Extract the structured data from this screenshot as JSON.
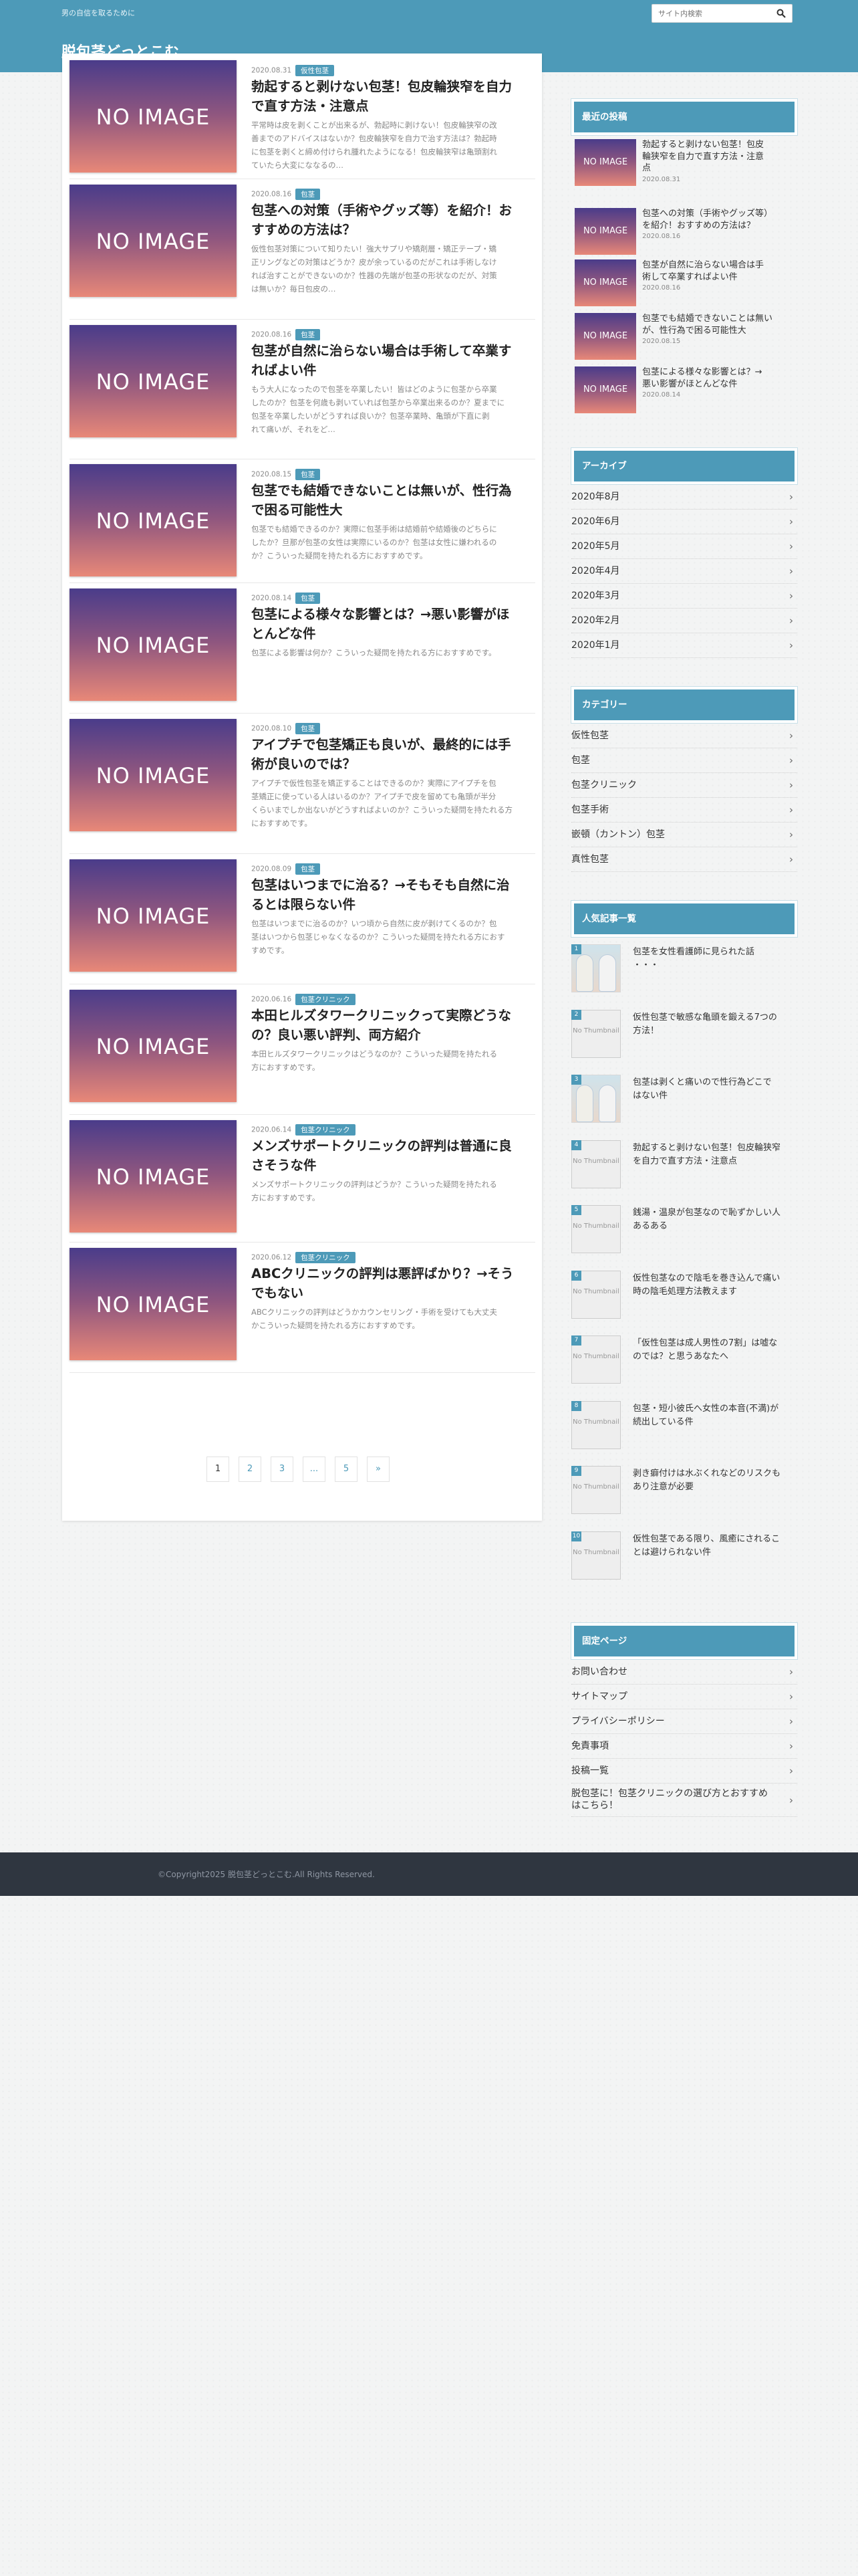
{
  "header": {
    "tagline": "男の自信を取るために",
    "title": "脱包茎どっとこむ",
    "search_placeholder": "サイト内検索",
    "search_icon": "search-icon"
  },
  "posts": [
    {
      "date": "2020.08.31",
      "category": "仮性包茎",
      "title_lines": [
        "勃起すると剥けない包茎！包皮輪狭窄を自力",
        "で直す方法・注意点"
      ],
      "excerpt_lines": [
        "平常時は皮を剥くことが出来るが、勃起時に剥けない！包皮輪狭窄の改",
        "善までのアドバイスはないか？包皮輪狭窄を自力で治す方法は？勃起時",
        "に包茎を剥くと締め付けられ腫れたようになる！包皮輪狭窄は亀頭割れ",
        "ていたら大変にななるの…"
      ],
      "thumb": "NO IMAGE"
    },
    {
      "date": "2020.08.16",
      "category": "包茎",
      "title_lines": [
        "包茎への対策（手術やグッズ等）を紹介！お",
        "すすめの方法は？"
      ],
      "excerpt_lines": [
        "仮性包茎対策について知りたい！強大サプリや矯剤層・矯正テープ・矯",
        "正リングなどの対策はどうか？皮が余っているのだがこれは手術しなけ",
        "れば治すことができないのか？性器の先端が包茎の形状なのだが、対策",
        "は無いか？毎日包皮の…"
      ],
      "thumb": "NO IMAGE"
    },
    {
      "date": "2020.08.16",
      "category": "包茎",
      "title_lines": [
        "包茎が自然に治らない場合は手術して卒業す",
        "ればよい件"
      ],
      "excerpt_lines": [
        "もう大人になったので包茎を卒業したい！皆はどのように包茎から卒業",
        "したのか？包茎を何歳も剥いていれば包茎から卒業出来るのか？夏までに",
        "包茎を卒業したいがどうすれば良いか？包茎卒業時、亀頭が下直に剥",
        "れて痛いが、それをど…"
      ],
      "thumb": "NO IMAGE"
    },
    {
      "date": "2020.08.15",
      "category": "包茎",
      "title_lines": [
        "包茎でも結婚できないことは無いが、性行為",
        "で困る可能性大"
      ],
      "excerpt_lines": [
        "包茎でも結婚できるのか？実際に包茎手術は結婚前や結婚後のどちらに",
        "したか？旦那が包茎の女性は実際にいるのか？包茎は女性に嫌われるの",
        "か？こういった疑問を持たれる方におすすめです。"
      ],
      "thumb": "NO IMAGE"
    },
    {
      "date": "2020.08.14",
      "category": "包茎",
      "title_lines": [
        "包茎による様々な影響とは？→悪い影響がほ",
        "とんどな件"
      ],
      "excerpt_lines": [
        "包茎による影響は何か？こういった疑問を持たれる方におすすめです。"
      ],
      "thumb": "NO IMAGE"
    },
    {
      "date": "2020.08.10",
      "category": "包茎",
      "title_lines": [
        "アイプチで包茎矯正も良いが、最終的には手",
        "術が良いのでは？"
      ],
      "excerpt_lines": [
        "アイプチで仮性包茎を矯正することはできるのか？実際にアイプチを包",
        "茎矯正に使っている人はいるのか？アイプチで皮を留めても亀頭が半分",
        "くらいまでしか出ないがどうすればよいのか？こういった疑問を持たれる方",
        "におすすめです。"
      ],
      "thumb": "NO IMAGE"
    },
    {
      "date": "2020.08.09",
      "category": "包茎",
      "title_lines": [
        "包茎はいつまでに治る？→そもそも自然に治",
        "るとは限らない件"
      ],
      "excerpt_lines": [
        "包茎はいつまでに治るのか？いつ頃から自然に皮が剥けてくるのか？包",
        "茎はいつから包茎じゃなくなるのか？こういった疑問を持たれる方におす",
        "すめです。"
      ],
      "thumb": "NO IMAGE"
    },
    {
      "date": "2020.06.16",
      "category": "包茎クリニック",
      "title_lines": [
        "本田ヒルズタワークリニックって実際どうな",
        "の？良い悪い評判、両方紹介"
      ],
      "excerpt_lines": [
        "本田ヒルズタワークリニックはどうなのか？こういった疑問を持たれる",
        "方におすすめです。"
      ],
      "thumb": "NO IMAGE"
    },
    {
      "date": "2020.06.14",
      "category": "包茎クリニック",
      "title_lines": [
        "メンズサポートクリニックの評判は普通に良",
        "さそうな件"
      ],
      "excerpt_lines": [
        "メンズサポートクリニックの評判はどうか？こういった疑問を持たれる",
        "方におすすめです。"
      ],
      "thumb": "NO IMAGE"
    },
    {
      "date": "2020.06.12",
      "category": "包茎クリニック",
      "title_lines": [
        "ABCクリニックの評判は悪評ばかり？→そう",
        "でもない"
      ],
      "excerpt_lines": [
        "ABCクリニックの評判はどうかカウンセリング・手術を受けても大丈夫",
        "かこういった疑問を持たれる方におすすめです。"
      ],
      "thumb": "NO IMAGE"
    }
  ],
  "pagination": [
    "1",
    "2",
    "3",
    "...",
    "5",
    "»"
  ],
  "sidebar": {
    "recent": {
      "title": "最近の投稿",
      "items": [
        {
          "title_lines": [
            "勃起すると剥けない包茎！包皮",
            "輪狭窄を自力で直す方法・注意",
            "点"
          ],
          "date": "2020.08.31",
          "thumb": "NO IMAGE"
        },
        {
          "title_lines": [
            "包茎への対策（手術やグッズ等）",
            "を紹介！おすすめの方法は？"
          ],
          "date": "2020.08.16",
          "thumb": "NO IMAGE"
        },
        {
          "title_lines": [
            "包茎が自然に治らない場合は手",
            "術して卒業すればよい件"
          ],
          "date": "2020.08.16",
          "thumb": "NO IMAGE"
        },
        {
          "title_lines": [
            "包茎でも結婚できないことは無い",
            "が、性行為で困る可能性大"
          ],
          "date": "2020.08.15",
          "thumb": "NO IMAGE"
        },
        {
          "title_lines": [
            "包茎による様々な影響とは？→",
            "悪い影響がほとんどな件"
          ],
          "date": "2020.08.14",
          "thumb": "NO IMAGE"
        }
      ]
    },
    "archive": {
      "title": "アーカイブ",
      "items": [
        "2020年8月",
        "2020年6月",
        "2020年5月",
        "2020年4月",
        "2020年3月",
        "2020年2月",
        "2020年1月"
      ]
    },
    "categories": {
      "title": "カテゴリー",
      "items": [
        "仮性包茎",
        "包茎",
        "包茎クリニック",
        "包茎手術",
        "嵌頓（カントン）包茎",
        "真性包茎"
      ]
    },
    "popular": {
      "title": "人気記事一覧",
      "items": [
        {
          "rank": "1",
          "title_lines": [
            "包茎を女性看護師に見られた話",
            "・・・"
          ],
          "thumb": "photo"
        },
        {
          "rank": "2",
          "title_lines": [
            "仮性包茎で敏感な亀頭を鍛える7つの",
            "方法！"
          ],
          "thumb": "No Thumbnail"
        },
        {
          "rank": "3",
          "title_lines": [
            "包茎は剥くと痛いので性行為どこで",
            "はない件"
          ],
          "thumb": "photo"
        },
        {
          "rank": "4",
          "title_lines": [
            "勃起すると剥けない包茎！包皮輪狭窄",
            "を自力で直す方法・注意点"
          ],
          "thumb": "No Thumbnail"
        },
        {
          "rank": "5",
          "title_lines": [
            "銭湯・温泉が包茎なので恥ずかしい人",
            "あるある"
          ],
          "thumb": "No Thumbnail"
        },
        {
          "rank": "6",
          "title_lines": [
            "仮性包茎なので陰毛を巻き込んで痛い",
            "時の陰毛処理方法教えます"
          ],
          "thumb": "No Thumbnail"
        },
        {
          "rank": "7",
          "title_lines": [
            "「仮性包茎は成人男性の7割」は嘘な",
            "のでは？と思うあなたへ"
          ],
          "thumb": "No Thumbnail"
        },
        {
          "rank": "8",
          "title_lines": [
            "包茎・短小彼氏へ女性の本音(不満)が",
            "続出している件"
          ],
          "thumb": "No Thumbnail"
        },
        {
          "rank": "9",
          "title_lines": [
            "剥き癖付けは水ぶくれなどのリスクも",
            "あり注意が必要"
          ],
          "thumb": "No Thumbnail"
        },
        {
          "rank": "10",
          "title_lines": [
            "仮性包茎である限り、風癒にされるこ",
            "とは避けられない件"
          ],
          "thumb": "No Thumbnail"
        }
      ]
    },
    "fixed": {
      "title": "固定ページ",
      "items": [
        [
          "お問い合わせ"
        ],
        [
          "サイトマップ"
        ],
        [
          "プライバシーポリシー"
        ],
        [
          "免責事項"
        ],
        [
          "投稿一覧"
        ],
        [
          "脱包茎に！包茎クリニックの選び方とおすすめ",
          "はこちら！"
        ]
      ]
    }
  },
  "footer": {
    "copyright": "©Copyright2025 脱包茎どっとこむ.All Rights Reserved."
  }
}
